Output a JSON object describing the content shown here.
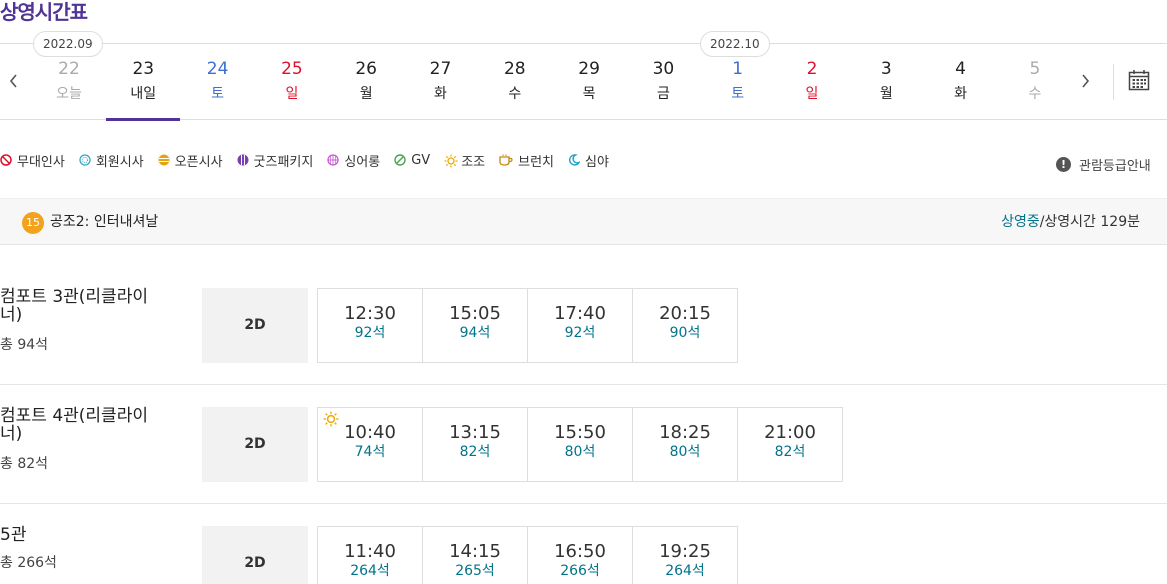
{
  "page": {
    "title": "상영시간표"
  },
  "dates": {
    "months": [
      "2022.09",
      "2022.10"
    ],
    "days": [
      {
        "num": "22",
        "week": "오늘",
        "color": "dim"
      },
      {
        "num": "23",
        "week": "내일",
        "color": "dark",
        "selected": true
      },
      {
        "num": "24",
        "week": "토",
        "color": "blue"
      },
      {
        "num": "25",
        "week": "일",
        "color": "red"
      },
      {
        "num": "26",
        "week": "월",
        "color": "dark"
      },
      {
        "num": "27",
        "week": "화",
        "color": "dark"
      },
      {
        "num": "28",
        "week": "수",
        "color": "dark"
      },
      {
        "num": "29",
        "week": "목",
        "color": "dark"
      },
      {
        "num": "30",
        "week": "금",
        "color": "dark"
      },
      {
        "num": "1",
        "week": "토",
        "color": "blue"
      },
      {
        "num": "2",
        "week": "일",
        "color": "red"
      },
      {
        "num": "3",
        "week": "월",
        "color": "dark"
      },
      {
        "num": "4",
        "week": "화",
        "color": "dark"
      },
      {
        "num": "5",
        "week": "수",
        "color": "dim"
      }
    ],
    "prev_icon": "chevron-left-icon",
    "next_icon": "chevron-right-icon",
    "calendar_icon": "calendar-icon"
  },
  "legend": {
    "items": [
      {
        "label": "무대인사",
        "icon": "no-entry-icon",
        "color": "#e0102b"
      },
      {
        "label": "회원시사",
        "icon": "circle-dot-icon",
        "color": "#3aa3c9"
      },
      {
        "label": "오픈시사",
        "icon": "striped-circle-icon",
        "color": "#e6a316"
      },
      {
        "label": "굿즈패키지",
        "icon": "striped-circle-icon",
        "color": "#7a3fb0"
      },
      {
        "label": "싱어롱",
        "icon": "grid-circle-icon",
        "color": "#c45ad1"
      },
      {
        "label": "GV",
        "icon": "slash-circle-icon",
        "color": "#4aa54a"
      },
      {
        "label": "조조",
        "icon": "sun-icon",
        "color": "#f0a800"
      },
      {
        "label": "브런치",
        "icon": "cup-icon",
        "color": "#c8860a"
      },
      {
        "label": "심야",
        "icon": "moon-icon",
        "color": "#1aa0c8"
      }
    ],
    "rating_info": "관람등급안내"
  },
  "movie": {
    "age": "15",
    "title": "공조2: 인터내셔날",
    "status": "상영중",
    "runtime": "/상영시간 129분"
  },
  "halls": [
    {
      "name": "컴포트 3관(리클라이너)",
      "seats": "총 94석",
      "format": "2D",
      "slots": [
        {
          "time": "12:30",
          "seats": "92석"
        },
        {
          "time": "15:05",
          "seats": "94석"
        },
        {
          "time": "17:40",
          "seats": "92석"
        },
        {
          "time": "20:15",
          "seats": "90석"
        }
      ]
    },
    {
      "name": "컴포트 4관(리클라이너)",
      "seats": "총 82석",
      "format": "2D",
      "slots": [
        {
          "time": "10:40",
          "seats": "74석",
          "morning": true
        },
        {
          "time": "13:15",
          "seats": "82석"
        },
        {
          "time": "15:50",
          "seats": "80석"
        },
        {
          "time": "18:25",
          "seats": "80석"
        },
        {
          "time": "21:00",
          "seats": "82석"
        }
      ]
    },
    {
      "name": "5관",
      "seats": "총 266석",
      "format": "2D",
      "slots": [
        {
          "time": "11:40",
          "seats": "264석"
        },
        {
          "time": "14:15",
          "seats": "265석"
        },
        {
          "time": "16:50",
          "seats": "266석"
        },
        {
          "time": "19:25",
          "seats": "264석"
        }
      ]
    }
  ]
}
